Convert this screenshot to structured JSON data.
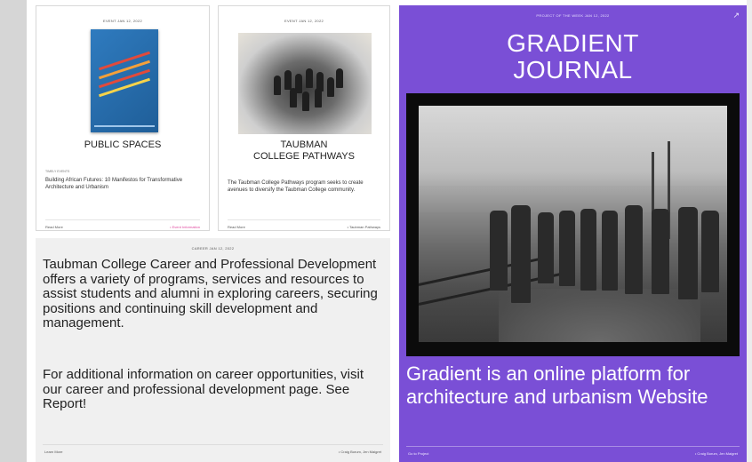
{
  "card_public_spaces": {
    "date": "EVENT JAN 12, 2022",
    "title": "PUBLIC SPACES",
    "category": "TIMELY EVENTS",
    "description": "Building African Futures: 10 Manifestos for Transformative Architecture and Urbanism",
    "footer_left": "Read More",
    "footer_right": "• Event Information",
    "accent_color": "#e0479e"
  },
  "card_pathways": {
    "date": "EVENT JAN 12, 2022",
    "title_line1": "TAUBMAN",
    "title_line2": "COLLEGE PATHWAYS",
    "description": "The Taubman College Pathways program seeks to create avenues to diversify the Taubman College community.",
    "footer_left": "Read More",
    "footer_right": "• Taubman Pathways"
  },
  "careers": {
    "date": "CAREER JAN 12, 2022",
    "paragraph1": "Taubman College Career and Professional Development offers a variety of programs, services and resources to assist students and alumni in exploring careers, securing positions and continuing skill development and management.",
    "paragraph2": "For additional information on career opportunities, visit our career and professional development page. See Report!",
    "footer_left": "Learn More",
    "footer_right": "• Craig Borum, Jen Maigret"
  },
  "journal": {
    "date": "PROJECT OF THE WEEK JAN 12, 2022",
    "share_icon": "share-icon",
    "title_line1": "GRADIENT",
    "title_line2": "JOURNAL",
    "description": "Gradient is an online platform for architecture and urbanism Website",
    "footer_left": "Go to Project",
    "footer_right": "• Craig Borum, Jen Maigret",
    "background_color": "#7a4fd6"
  }
}
